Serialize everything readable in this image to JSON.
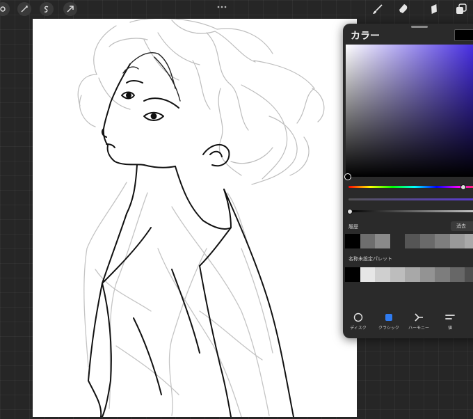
{
  "toolbar": {
    "left_tools": [
      "adjustments-icon",
      "selection-icon",
      "transform-icon"
    ],
    "right_tools": [
      "brush-icon",
      "smudge-icon",
      "eraser-icon",
      "layers-icon"
    ],
    "more_icon": "more-dots-icon"
  },
  "colors": {
    "canvas_bg": "#ffffff",
    "app_bg": "#262626",
    "panel_bg": "#2a2a2a",
    "current_color": "#000000",
    "hue_color": "#3a1fe0",
    "active_tab": "#2f7bf0"
  },
  "color_panel": {
    "title": "カラー",
    "history_label": "履歴",
    "clear_label": "消去",
    "history_swatches": [
      "#000000",
      "#6e6e6e",
      "#8a8a8a",
      "#2a2a2a",
      "#555555",
      "#6a6a6a",
      "#7e7e7e",
      "#9a9a9a",
      "#a9a9a9"
    ],
    "palette_label": "名称未設定パレット",
    "palette_swatches": [
      "#000000",
      "#e6e6e6",
      "#cfcfcf",
      "#bdbdbd",
      "#a8a8a8",
      "#939393",
      "#7d7d7d",
      "#676767",
      "#4f4f4f"
    ],
    "sliders": {
      "hue_fraction": 0.87,
      "saturation_fraction": 0.99,
      "brightness_fraction": 0.01
    }
  },
  "footer_tabs": [
    {
      "label": "ディスク",
      "icon": "disc-icon"
    },
    {
      "label": "クラシック",
      "icon": "classic-square-icon",
      "active": true
    },
    {
      "label": "ハーモニー",
      "icon": "harmony-icon"
    },
    {
      "label": "値",
      "icon": "value-sliders-icon"
    }
  ]
}
